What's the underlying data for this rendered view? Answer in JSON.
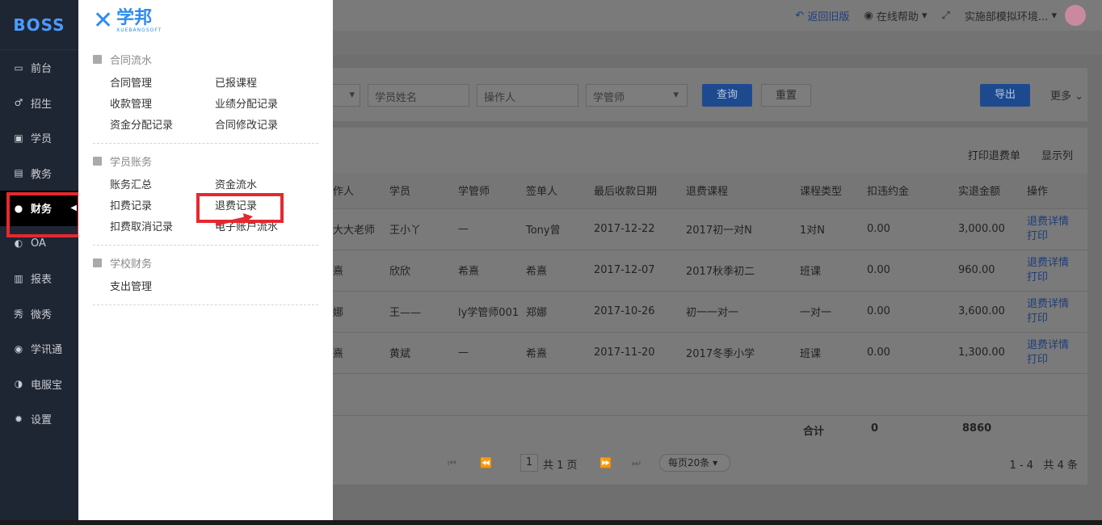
{
  "sidebar": {
    "logo": "BOSS",
    "items": [
      {
        "label": "前台",
        "icon": "calendar-icon",
        "glyph": "▭"
      },
      {
        "label": "招生",
        "icon": "user-plus-icon",
        "glyph": "♂"
      },
      {
        "label": "学员",
        "icon": "id-card-icon",
        "glyph": "▣"
      },
      {
        "label": "教务",
        "icon": "book-icon",
        "glyph": "▤"
      },
      {
        "label": "财务",
        "icon": "yen-circle-icon",
        "glyph": "●"
      },
      {
        "label": "OA",
        "icon": "toggle-icon",
        "glyph": "◐"
      },
      {
        "label": "报表",
        "icon": "bar-chart-icon",
        "glyph": "▥"
      },
      {
        "label": "微秀",
        "icon": "xiu-icon",
        "glyph": "秀"
      },
      {
        "label": "学讯通",
        "icon": "location-icon",
        "glyph": "◉"
      },
      {
        "label": "电服宝",
        "icon": "phone-icon",
        "glyph": "◑"
      },
      {
        "label": "设置",
        "icon": "gear-icon",
        "glyph": "✹"
      }
    ]
  },
  "flyout": {
    "brand_cn": "学邦",
    "brand_en": "XUEBANGSOFT",
    "sections": [
      {
        "title": "合同流水",
        "links": [
          "合同管理",
          "已报课程",
          "收款管理",
          "业绩分配记录",
          "资金分配记录",
          "合同修改记录"
        ]
      },
      {
        "title": "学员账务",
        "links": [
          "账务汇总",
          "资金流水",
          "扣费记录",
          "退费记录",
          "扣费取消记录",
          "电子账户流水"
        ]
      },
      {
        "title": "学校财务",
        "links": [
          "支出管理"
        ]
      }
    ]
  },
  "topbar": {
    "back": "返回旧版",
    "help": "在线帮助",
    "env": "实施部模拟环境..."
  },
  "filter": {
    "student_placeholder": "学员姓名",
    "operator_placeholder": "操作人",
    "role_select": "学管师",
    "query": "查询",
    "reset": "重置",
    "export": "导出",
    "more": "更多"
  },
  "panel": {
    "print": "打印退费单",
    "columns_toggle": "显示列"
  },
  "table": {
    "headers": [
      "作人",
      "学员",
      "学管师",
      "签单人",
      "最后收款日期",
      "退费课程",
      "课程类型",
      "扣违约金",
      "实退金额",
      "操作"
    ],
    "rows": [
      [
        "大大老师",
        "王小丫",
        "—",
        "Tony曾",
        "2017-12-22",
        "2017初一对N",
        "1对N",
        "0.00",
        "3,000.00"
      ],
      [
        "熹",
        "欣欣",
        "希熹",
        "希熹",
        "2017-12-07",
        "2017秋季初二",
        "班课",
        "0.00",
        "960.00"
      ],
      [
        "娜",
        "王——",
        "ly学管师001",
        "郑娜",
        "2017-10-26",
        "初一一对一",
        "一对一",
        "0.00",
        "3,600.00"
      ],
      [
        "熹",
        "黄斌",
        "—",
        "希熹",
        "2017-11-20",
        "2017冬季小学",
        "班课",
        "0.00",
        "1,300.00"
      ]
    ],
    "op_detail": "退费详情",
    "op_print": "打印"
  },
  "totals": {
    "label": "合计",
    "penalty": "0",
    "refund": "8860"
  },
  "pager": {
    "page": "1",
    "total_pages": "共 1 页",
    "per_page": "每页20条",
    "range": "1 - 4",
    "count": "共 4 条"
  }
}
